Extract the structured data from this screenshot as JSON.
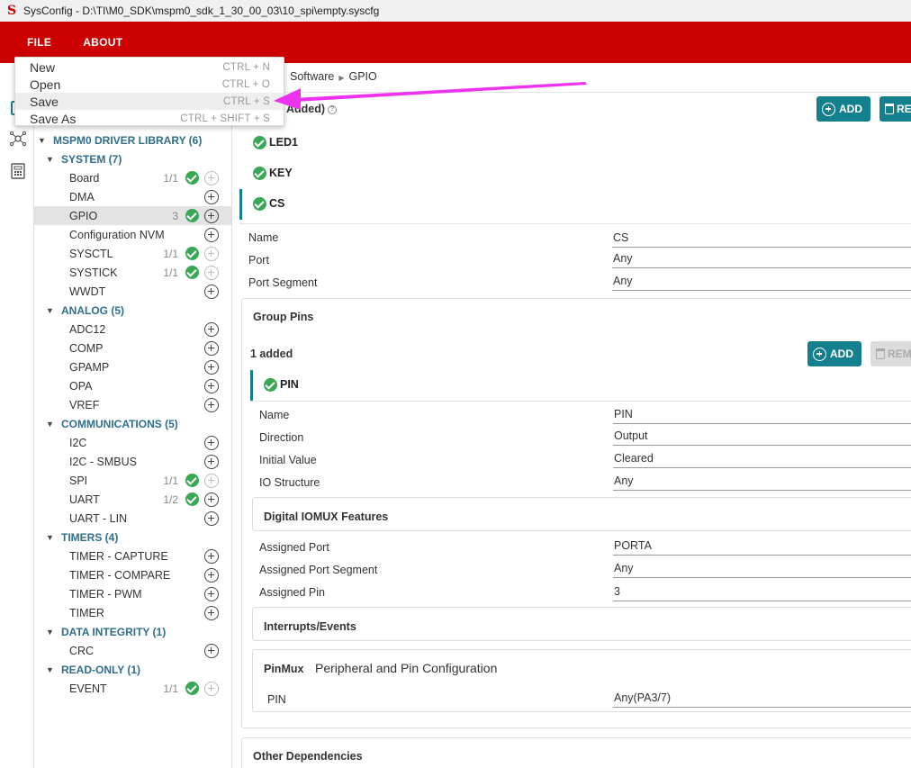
{
  "window": {
    "title": "SysConfig - D:\\TI\\M0_SDK\\mspm0_sdk_1_30_00_03\\10_spi\\empty.syscfg",
    "logo": "S"
  },
  "menubar": {
    "file": "FILE",
    "about": "ABOUT"
  },
  "file_menu": {
    "items": [
      {
        "label": "New",
        "shortcut": "CTRL + N"
      },
      {
        "label": "Open",
        "shortcut": "CTRL + O"
      },
      {
        "label": "Save",
        "shortcut": "CTRL + S"
      },
      {
        "label": "Save As",
        "shortcut": "CTRL + SHIFT + S"
      }
    ]
  },
  "sidebar": {
    "library": "MSPM0 DRIVER LIBRARY (6)",
    "categories": [
      {
        "label": "SYSTEM (7)",
        "items": [
          {
            "label": "Board",
            "count": "1/1",
            "checked": true
          },
          {
            "label": "DMA",
            "count": "",
            "checked": false
          },
          {
            "label": "GPIO",
            "count": "3",
            "checked": true,
            "selected": true
          },
          {
            "label": "Configuration NVM",
            "count": "",
            "checked": false
          },
          {
            "label": "SYSCTL",
            "count": "1/1",
            "checked": true
          },
          {
            "label": "SYSTICK",
            "count": "1/1",
            "checked": true
          },
          {
            "label": "WWDT",
            "count": "",
            "checked": false
          }
        ]
      },
      {
        "label": "ANALOG (5)",
        "items": [
          {
            "label": "ADC12"
          },
          {
            "label": "COMP"
          },
          {
            "label": "GPAMP"
          },
          {
            "label": "OPA"
          },
          {
            "label": "VREF"
          }
        ]
      },
      {
        "label": "COMMUNICATIONS (5)",
        "items": [
          {
            "label": "I2C"
          },
          {
            "label": "I2C - SMBUS"
          },
          {
            "label": "SPI",
            "count": "1/1",
            "checked": true
          },
          {
            "label": "UART",
            "count": "1/2",
            "checked": true
          },
          {
            "label": "UART - LIN"
          }
        ]
      },
      {
        "label": "TIMERS (4)",
        "items": [
          {
            "label": "TIMER - CAPTURE"
          },
          {
            "label": "TIMER - COMPARE"
          },
          {
            "label": "TIMER - PWM"
          },
          {
            "label": "TIMER"
          }
        ]
      },
      {
        "label": "DATA INTEGRITY (1)",
        "items": [
          {
            "label": "CRC"
          }
        ]
      },
      {
        "label": "READ-ONLY (1)",
        "items": [
          {
            "label": "EVENT",
            "count": "1/1",
            "checked": true
          }
        ]
      }
    ]
  },
  "main": {
    "breadcrumb": {
      "software": "Software",
      "gpio": "GPIO"
    },
    "added_title": "Added)",
    "add_label": "ADD",
    "remove_label": "RE",
    "instances": [
      "LED1",
      "KEY",
      "CS"
    ],
    "fields": [
      {
        "label": "Name",
        "value": "CS"
      },
      {
        "label": "Port",
        "value": "Any"
      },
      {
        "label": "Port Segment",
        "value": "Any"
      }
    ],
    "group_pins": {
      "title": "Group Pins",
      "added": "1 added",
      "add_label": "ADD",
      "remove_label": "REM",
      "pin": "PIN",
      "fields": [
        {
          "label": "Name",
          "value": "PIN"
        },
        {
          "label": "Direction",
          "value": "Output"
        },
        {
          "label": "Initial Value",
          "value": "Cleared"
        },
        {
          "label": "IO Structure",
          "value": "Any"
        }
      ],
      "digital_iomux": {
        "title": "Digital IOMUX Features",
        "fields": [
          {
            "label": "Assigned Port",
            "value": "PORTA"
          },
          {
            "label": "Assigned Port Segment",
            "value": "Any"
          },
          {
            "label": "Assigned Pin",
            "value": "3"
          }
        ]
      },
      "interrupts_title": "Interrupts/Events",
      "pinmux": {
        "title": "PinMux",
        "subtitle": "Peripheral and Pin Configuration",
        "pin_label": "PIN",
        "pin_value": "Any(PA3/7)"
      }
    },
    "other_dependencies": "Other Dependencies"
  },
  "colors": {
    "menubar": "#cc0000",
    "accent": "#15808d",
    "check": "#3aa757",
    "arrow": "#ee33ee"
  }
}
